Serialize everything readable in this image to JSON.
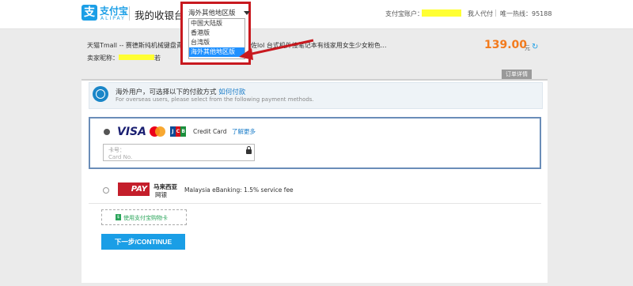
{
  "header": {
    "logo_glyph": "支",
    "logo_cn": "支付宝",
    "logo_en": "ALIPAY",
    "cashier_title": "我的收银台",
    "account_label": "支付宝账户：",
    "links": [
      "我人代付",
      "唯一热线：95188"
    ]
  },
  "region_select": {
    "current": "海外其他地区版",
    "options": [
      "中国大陆版",
      "香港版",
      "台湾版",
      "海外其他地区版"
    ],
    "selected_index": 3
  },
  "order": {
    "title_prefix": "天猫Tmall -- 赛德斯纯机械键盘青轴黑",
    "title_suffix": "佐lol 台式机外接笔记本有线家用女生少女粉色...",
    "seller_label": "卖家昵称：",
    "seller_tail": "若",
    "price": "139.00",
    "unit": "元",
    "details_button": "订单详情"
  },
  "notice": {
    "cn": "海外用户，可选择以下的付款方式",
    "link": "如何付款",
    "en": "For overseas users, please select from the following payment methods."
  },
  "payment": {
    "card": {
      "selected": true,
      "brands": [
        "VISA",
        "JCB"
      ],
      "label": "Credit Card",
      "learn_more": "了解更多",
      "input_label": "卡号：",
      "input_placeholder": "Card No."
    },
    "mypay": {
      "logo": "PAY",
      "name_line1": "马来西亚",
      "name_line2": "网银",
      "label": "Malaysia eBanking: 1.5% service fee"
    }
  },
  "voucher": {
    "label": "使用支付宝购物卡",
    "icon": "$"
  },
  "continue_button": "下一步/CONTINUE",
  "colors": {
    "brand": "#1a9ee6",
    "price": "#f37b1d",
    "highlight_box": "#c8191f",
    "option_selected": "#1e90ff",
    "redaction": "#ffff33"
  }
}
